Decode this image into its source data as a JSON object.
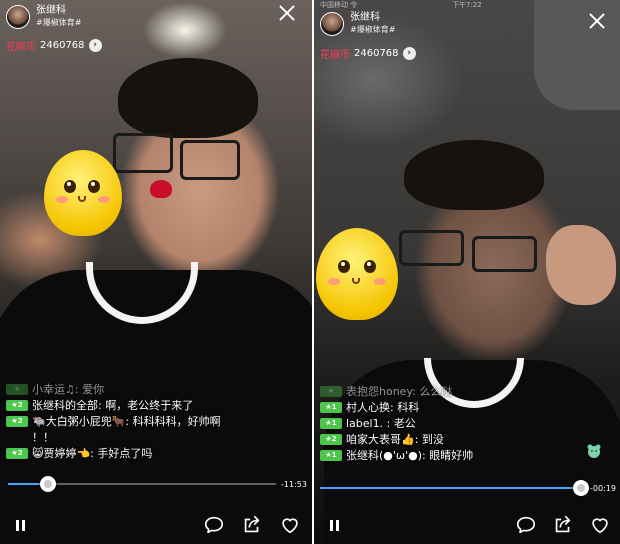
{
  "left": {
    "host": {
      "name": "张继科",
      "tag": "#爆椒体育#"
    },
    "currency": {
      "label": "花椒币",
      "value": "2460768"
    },
    "comments": [
      {
        "level": "",
        "text": "小幸运♫: 爱你",
        "faded": true
      },
      {
        "level": "2",
        "text": "张继科的全部: 啊，老公终于来了"
      },
      {
        "level": "2",
        "text": "🐃大白粥小屁兜🐂: 科科科科，好帅啊\n！！"
      },
      {
        "level": "2",
        "text": "😸贾婷婷👈: 手好点了吗"
      }
    ],
    "progress": {
      "fraction": 0.15,
      "time": "-11:53"
    }
  },
  "right": {
    "status": {
      "carrier": "中国移动 令",
      "time": "下午7:22"
    },
    "host": {
      "name": "张继科",
      "tag": "#爆椒体育#"
    },
    "currency": {
      "label": "花椒币",
      "value": "2460768"
    },
    "comments": [
      {
        "level": "",
        "text": "表抱怨honey: 么么哒",
        "faded": true
      },
      {
        "level": "1",
        "text": "村人心换: 科科"
      },
      {
        "level": "1",
        "text": "label1. : 老公"
      },
      {
        "level": "2",
        "text": "咱家大表哥👍: 到没"
      },
      {
        "level": "1",
        "text": "张继科(●'ω'●): 眼睛好帅"
      }
    ],
    "progress": {
      "fraction": 0.99,
      "time": "-00:19"
    }
  },
  "colors": {
    "accent": "#4aa3ff",
    "currency_label": "#ff3a55",
    "level_badge": "#4cc64c"
  },
  "icons": [
    "close-icon",
    "chevron-right-icon",
    "pause-icon",
    "comment-icon",
    "share-icon",
    "heart-icon"
  ]
}
